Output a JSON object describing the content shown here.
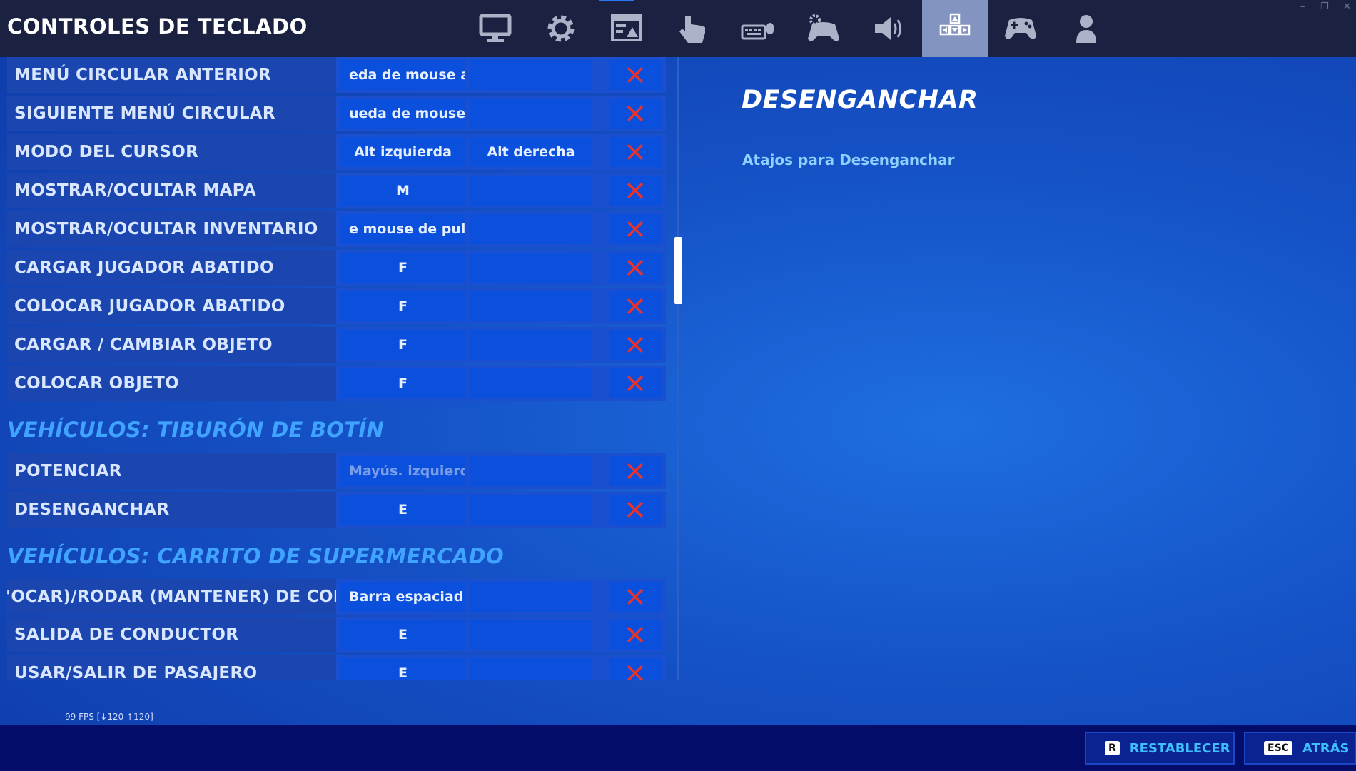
{
  "header": {
    "title": "CONTROLES DE TECLADO",
    "tabs": [
      {
        "icon": "monitor-icon"
      },
      {
        "icon": "gear-icon"
      },
      {
        "icon": "image-settings-icon"
      },
      {
        "icon": "touch-hand-icon"
      },
      {
        "icon": "keyboard-mouse-icon"
      },
      {
        "icon": "gamepad-gear-icon"
      },
      {
        "icon": "speaker-icon"
      },
      {
        "icon": "arrow-keys-icon",
        "active": true
      },
      {
        "icon": "gamepad-icon"
      },
      {
        "icon": "user-icon"
      }
    ],
    "window_controls": [
      "–",
      "❐",
      "✕"
    ]
  },
  "bindings": [
    {
      "label": "MENÚ CIRCULAR ANTERIOR",
      "key1": "eda de mouse a",
      "key2": ""
    },
    {
      "label": "SIGUIENTE MENÚ CIRCULAR",
      "key1": "ueda de mouse",
      "key2": ""
    },
    {
      "label": "MODO DEL CURSOR",
      "key1": "Alt izquierda",
      "key2": "Alt derecha"
    },
    {
      "label": "MOSTRAR/OCULTAR MAPA",
      "key1": "M",
      "key2": ""
    },
    {
      "label": "MOSTRAR/OCULTAR INVENTARIO",
      "key1": "e mouse de pul",
      "key2": ""
    },
    {
      "label": "CARGAR JUGADOR ABATIDO",
      "key1": "F",
      "key2": ""
    },
    {
      "label": "COLOCAR JUGADOR ABATIDO",
      "key1": "F",
      "key2": ""
    },
    {
      "label": "CARGAR / CAMBIAR OBJETO",
      "key1": "F",
      "key2": ""
    },
    {
      "label": "COLOCAR OBJETO",
      "key1": "F",
      "key2": ""
    }
  ],
  "sections": [
    {
      "title": "VEHÍCULOS: TIBURÓN DE BOTÍN",
      "bindings": [
        {
          "label": "POTENCIAR",
          "key1": "Mayús. izquierda",
          "key2": ""
        },
        {
          "label": "DESENGANCHAR",
          "key1": "E",
          "key2": ""
        }
      ]
    },
    {
      "title": "VEHÍCULOS: CARRITO DE SUPERMERCADO",
      "bindings": [
        {
          "label": "'OCAR)/RODAR (MANTENER) DE CONDUCT",
          "key1": "Barra espaciad",
          "key2": ""
        },
        {
          "label": "SALIDA DE CONDUCTOR",
          "key1": "E",
          "key2": ""
        },
        {
          "label": "USAR/SALIR DE PASAJERO",
          "key1": "E",
          "key2": ""
        }
      ]
    }
  ],
  "detail": {
    "title": "DESENGANCHAR",
    "description": "Atajos para Desenganchar"
  },
  "fps_text": "99 FPS [↓120 ↑120]",
  "footer": {
    "reset": {
      "key": "R",
      "label": "RESTABLECER"
    },
    "back": {
      "key": "ESC",
      "label": "ATRÁS"
    }
  },
  "colors": {
    "accent": "#3fa3ff",
    "clear_x": "#e8322a",
    "active_tab": "#8494c0"
  }
}
